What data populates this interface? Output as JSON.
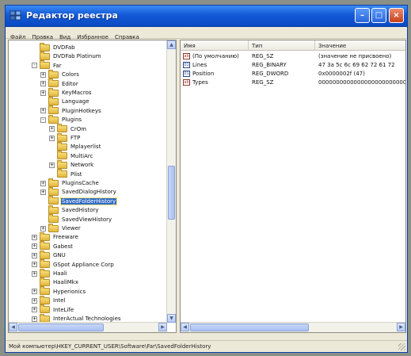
{
  "window": {
    "title": "Редактор реестра",
    "controls": {
      "minimize": "–",
      "maximize": "□",
      "close": "×"
    }
  },
  "menu": [
    "Файл",
    "Правка",
    "Вид",
    "Избранное",
    "Справка"
  ],
  "tree": [
    {
      "label": "DVDFab",
      "level": 3,
      "expander": "none"
    },
    {
      "label": "DVDFab Platinum",
      "level": 3,
      "expander": "none"
    },
    {
      "label": "Far",
      "level": 3,
      "expander": "-"
    },
    {
      "label": "Colors",
      "level": 4,
      "expander": "+"
    },
    {
      "label": "Editor",
      "level": 4,
      "expander": "+"
    },
    {
      "label": "KeyMacros",
      "level": 4,
      "expander": "+"
    },
    {
      "label": "Language",
      "level": 4,
      "expander": "none"
    },
    {
      "label": "PluginHotkeys",
      "level": 4,
      "expander": "+"
    },
    {
      "label": "Plugins",
      "level": 4,
      "expander": "-"
    },
    {
      "label": "CrOm",
      "level": 5,
      "expander": "+"
    },
    {
      "label": "FTP",
      "level": 5,
      "expander": "+"
    },
    {
      "label": "Mplayerlist",
      "level": 5,
      "expander": "none"
    },
    {
      "label": "MultiArc",
      "level": 5,
      "expander": "none"
    },
    {
      "label": "Network",
      "level": 5,
      "expander": "+"
    },
    {
      "label": "Plist",
      "level": 5,
      "expander": "none"
    },
    {
      "label": "PluginsCache",
      "level": 4,
      "expander": "+"
    },
    {
      "label": "SavedDialogHistory",
      "level": 4,
      "expander": "+"
    },
    {
      "label": "SavedFolderHistory",
      "level": 4,
      "expander": "none",
      "selected": true
    },
    {
      "label": "SavedHistory",
      "level": 4,
      "expander": "none"
    },
    {
      "label": "SavedViewHistory",
      "level": 4,
      "expander": "none"
    },
    {
      "label": "Viewer",
      "level": 4,
      "expander": "+"
    },
    {
      "label": "Freeware",
      "level": 3,
      "expander": "+"
    },
    {
      "label": "Gabest",
      "level": 3,
      "expander": "+"
    },
    {
      "label": "GNU",
      "level": 3,
      "expander": "+"
    },
    {
      "label": "GSpot Appliance Corp",
      "level": 3,
      "expander": "+"
    },
    {
      "label": "Haali",
      "level": 3,
      "expander": "+"
    },
    {
      "label": "HaaliMkx",
      "level": 3,
      "expander": "none"
    },
    {
      "label": "Hyperionics",
      "level": 3,
      "expander": "+"
    },
    {
      "label": "Intel",
      "level": 3,
      "expander": "+"
    },
    {
      "label": "InteLife",
      "level": 3,
      "expander": "+"
    },
    {
      "label": "InterActual Technologies",
      "level": 3,
      "expander": "+"
    }
  ],
  "values": {
    "headers": {
      "name": "Имя",
      "type": "Тип",
      "data": "Значение"
    },
    "rows": [
      {
        "icon": "ab",
        "name": "(По умолчанию)",
        "type": "REG_SZ",
        "data": "(значение не присвоено)"
      },
      {
        "icon": "bin",
        "name": "Lines",
        "type": "REG_BINARY",
        "data": "47 3a 5c 6c 69 62 72 61 72"
      },
      {
        "icon": "bin",
        "name": "Position",
        "type": "REG_DWORD",
        "data": "0x0000002f (47)"
      },
      {
        "icon": "ab",
        "name": "Types",
        "type": "REG_SZ",
        "data": "00000000000000000000000000"
      }
    ]
  },
  "status": "Мой компьютер\\HKEY_CURRENT_USER\\Software\\Far\\SavedFolderHistory"
}
